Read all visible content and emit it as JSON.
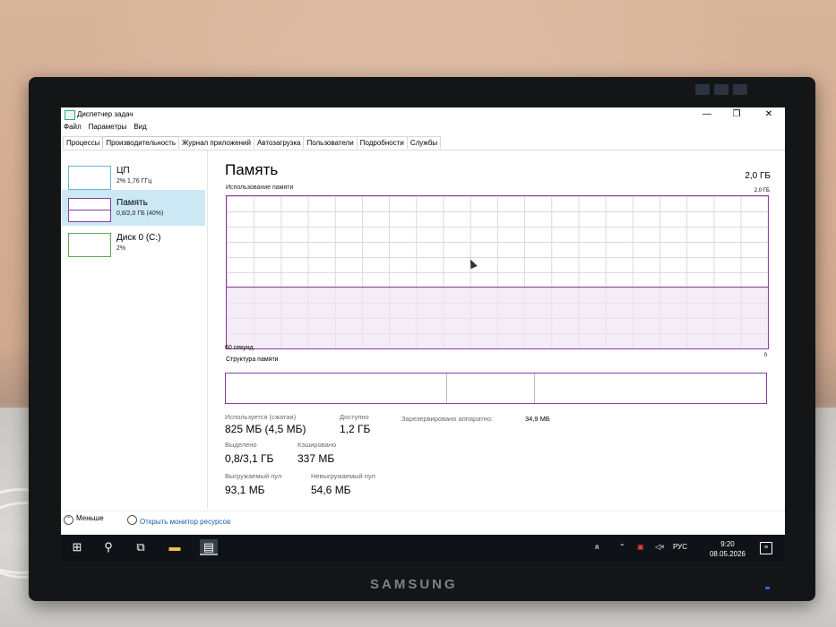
{
  "window": {
    "title": "Диспетчер задач",
    "controls": {
      "minimize": "—",
      "maximize": "❐",
      "close": "✕"
    }
  },
  "menu": [
    "Файл",
    "Параметры",
    "Вид"
  ],
  "tabs": [
    "Процессы",
    "Производительность",
    "Журнал приложений",
    "Автозагрузка",
    "Пользователи",
    "Подробности",
    "Службы"
  ],
  "active_tab": "Производительность",
  "sidebar": {
    "items": [
      {
        "name": "ЦП",
        "detail": "2% 1,76 ГГц",
        "selected": false
      },
      {
        "name": "Память",
        "detail": "0,8/2,0 ГБ (40%)",
        "selected": true
      },
      {
        "name": "Диск 0 (C:)",
        "detail": "2%",
        "selected": false
      }
    ]
  },
  "memory": {
    "title": "Память",
    "total": "2,0 ГБ",
    "chart_label": "Использование памяти",
    "chart_max": "2,0 ГБ",
    "time_label": "60 секунд",
    "zero": "0",
    "structure_label": "Структура памяти",
    "usage_fraction": 0.4,
    "structure_fractions": [
      0.41,
      0.16,
      0.43
    ],
    "stats": {
      "in_use_label": "Используется (сжатая)",
      "in_use_value": "825 МБ (4,5 МБ)",
      "available_label": "Доступно",
      "available_value": "1,2 ГБ",
      "reserved_label": "Зарезервировано аппаратно:",
      "reserved_value": "34,9 МБ",
      "committed_label": "Выделено",
      "committed_value": "0,8/3,1 ГБ",
      "cached_label": "Кэшировано",
      "cached_value": "337 МБ",
      "paged_label": "Выгружаемый пул",
      "paged_value": "93,1 МБ",
      "nonpaged_label": "Невыгружаемый пул",
      "nonpaged_value": "54,6 МБ"
    }
  },
  "footer": {
    "fewer_details": "Меньше",
    "open_monitor": "Открыть монитор ресурсов"
  },
  "taskbar": {
    "language": "РУС",
    "time": "9:20",
    "date": "08.05.2026"
  },
  "monitor": {
    "brand": "SAMSUNG"
  },
  "colors": {
    "memory_accent": "#8b3c9c",
    "cpu_accent": "#6bb3d6",
    "disk_accent": "#5fa85a",
    "selection": "#cce8f4",
    "link": "#1a5fb4"
  }
}
